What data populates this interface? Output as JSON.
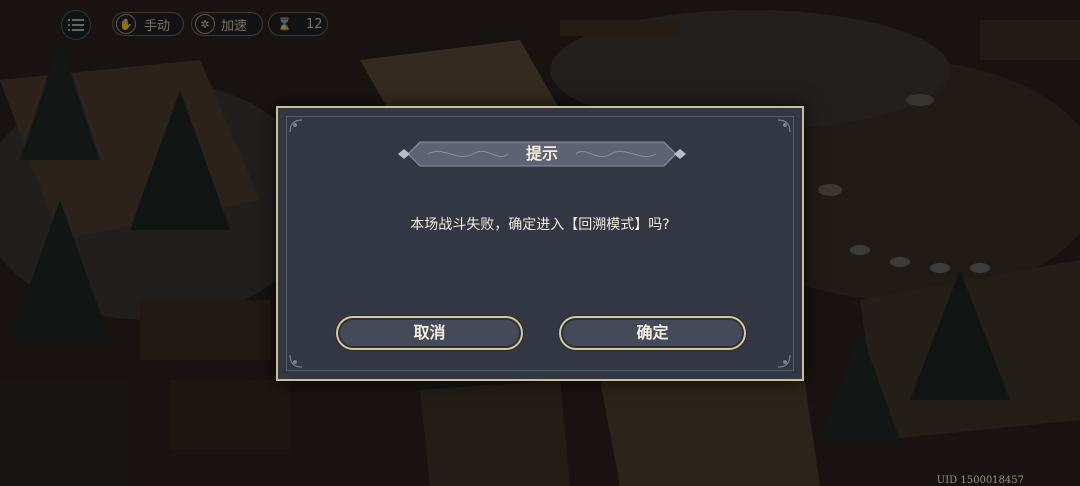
{
  "hud": {
    "mode_label": "手动",
    "speed_label": "加速",
    "turn_count": "12"
  },
  "dialog": {
    "title": "提示",
    "message": "本场战斗失败，确定进入【回溯模式】吗?",
    "cancel_label": "取消",
    "confirm_label": "确定"
  },
  "footer": {
    "uid": "UID 1500018457"
  },
  "colors": {
    "dialog_bg": "#333743",
    "dialog_border": "#cdbf95",
    "button_bg": "#454a59",
    "text": "#f1ece0"
  }
}
